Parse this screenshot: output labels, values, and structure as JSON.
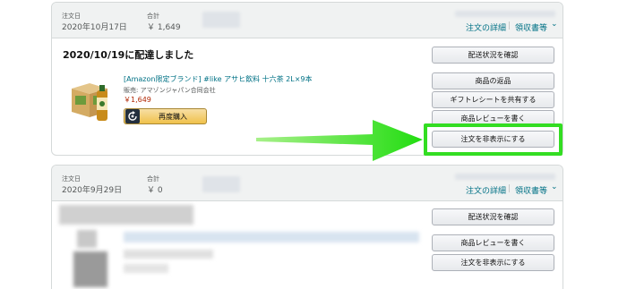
{
  "colors": {
    "highlight": "#33dd22",
    "link": "#007185",
    "price": "#b12704",
    "button_yellow": "#f0c14b"
  },
  "order1": {
    "order_date_label": "注文日",
    "order_date": "2020年10月17日",
    "total_label": "合計",
    "total": "￥ 1,649",
    "details_link": "注文の詳細",
    "separator": "|",
    "receipt_link": "領収書等",
    "receipt_chevron": "⌄",
    "status": "2020/10/19に配達しました",
    "buttons": {
      "track": "配送状況を確認",
      "return": "商品の返品",
      "gift_receipt": "ギフトレシートを共有する",
      "review": "商品レビューを書く",
      "hide": "注文を非表示にする"
    },
    "product": {
      "icon": "tea-box-icon",
      "title": "[Amazon限定ブランド] #like アサヒ飲料 十六茶 2L×9本",
      "seller": "販売: アマゾンジャパン合同会社",
      "price": "￥1,649",
      "rebuy_label": "再度購入",
      "rebuy_icon": "rebuy-icon"
    }
  },
  "order2": {
    "order_date_label": "注文日",
    "order_date": "2020年9月29日",
    "total_label": "合計",
    "total": "￥ 0",
    "details_link": "注文の詳細",
    "separator": "|",
    "receipt_link": "領収書等",
    "receipt_chevron": "⌄",
    "buttons": {
      "track": "配送状況を確認",
      "review": "商品レビューを書く",
      "hide": "注文を非表示にする"
    }
  }
}
